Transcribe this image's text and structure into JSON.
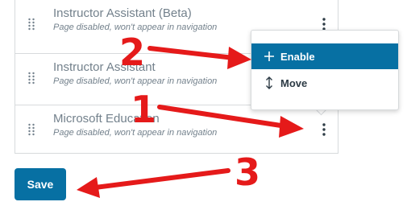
{
  "rows": [
    {
      "title": "Instructor Assistant (Beta)",
      "subtitle": "Page disabled, won't appear in navigation"
    },
    {
      "title": "Instructor Assistant",
      "subtitle": "Page disabled, won't appear in navigation"
    },
    {
      "title": "Microsoft Education",
      "subtitle": "Page disabled, won't appear in navigation"
    }
  ],
  "menu": {
    "items": [
      {
        "label": "Enable",
        "icon": "plus-icon",
        "active": true
      },
      {
        "label": "Move",
        "icon": "move-vertical-icon",
        "active": false
      }
    ]
  },
  "save_button": {
    "label": "Save"
  },
  "annotations": {
    "step_1": "1",
    "step_2": "2",
    "step_3": "3",
    "color": "#e51a1a"
  },
  "colors": {
    "primary": "#0770a3",
    "text_muted": "#73818c",
    "border": "#d7dadc"
  }
}
